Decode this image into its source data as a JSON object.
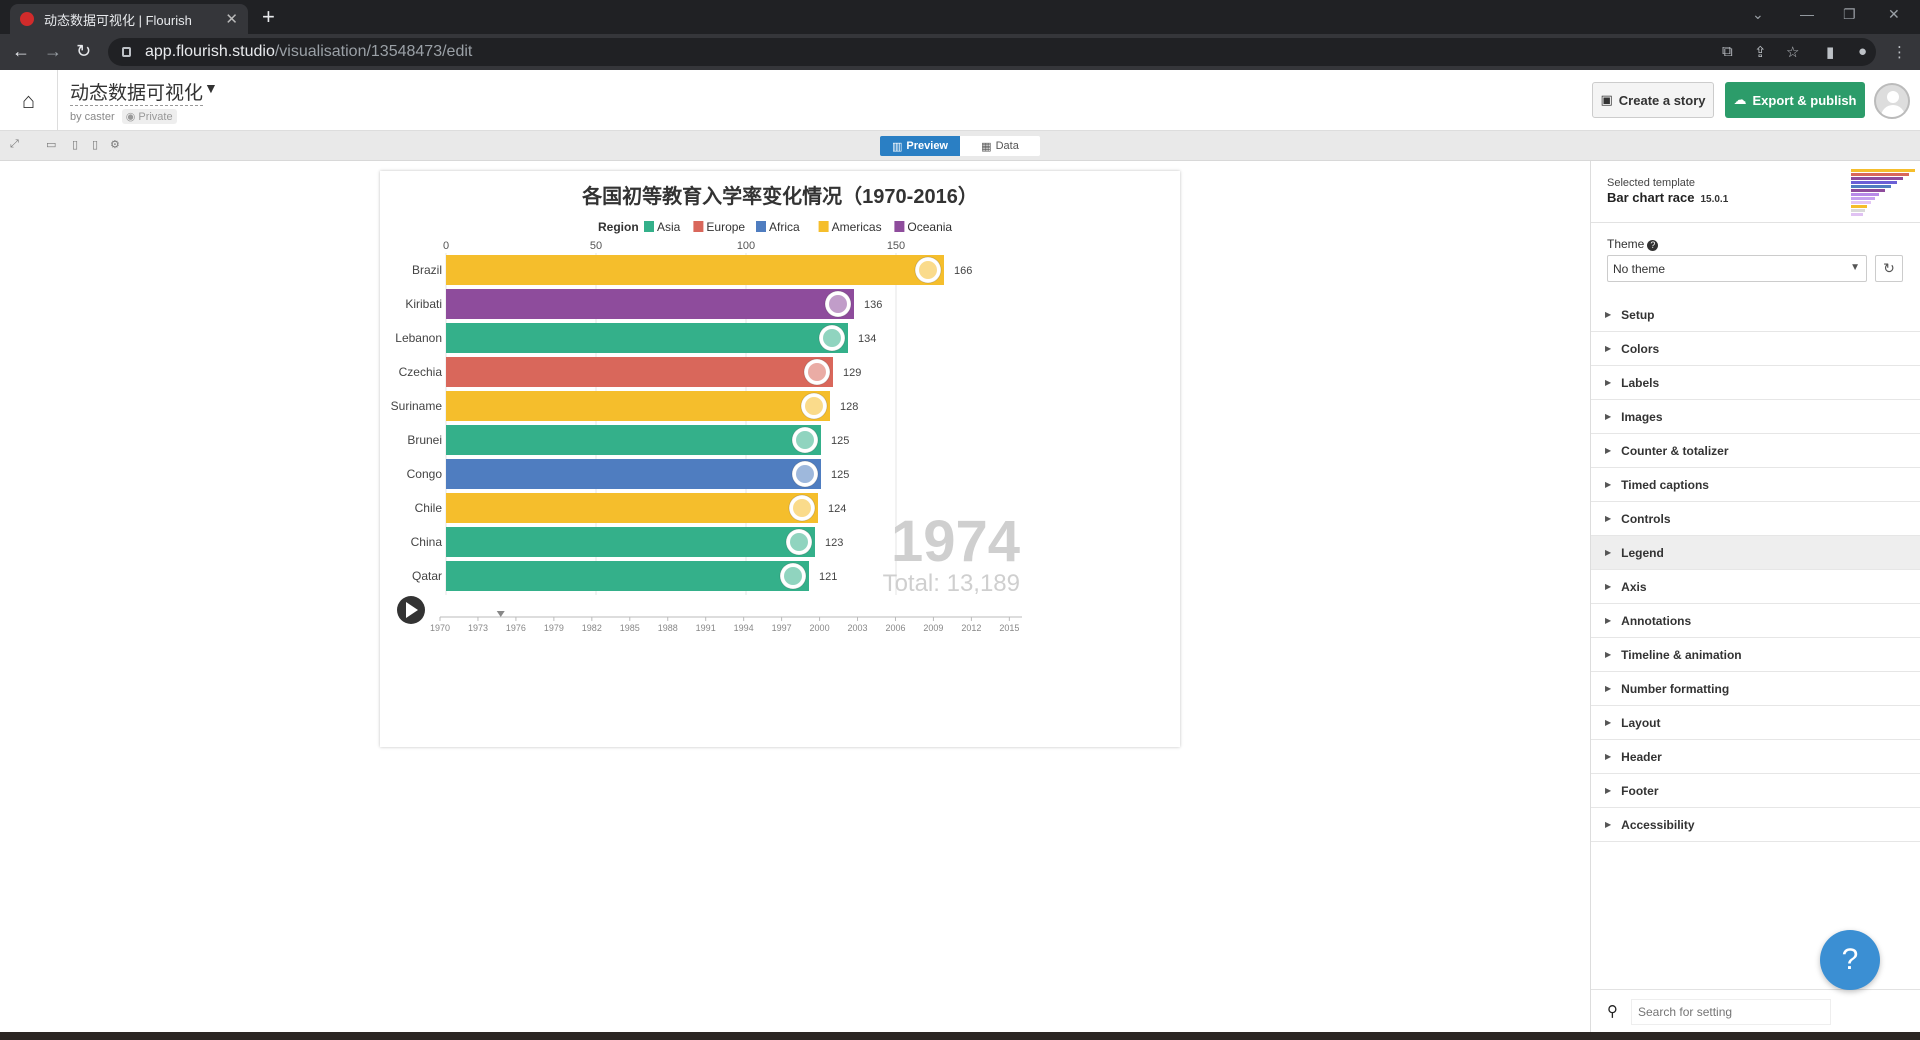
{
  "browser": {
    "tab_title": "动态数据可视化 | Flourish",
    "tab_close": "✕",
    "new_tab": "+",
    "url_host": "app.flourish.studio",
    "url_path": "/visualisation/13548473/edit"
  },
  "header": {
    "project_title": "动态数据可视化",
    "byline": "by caster",
    "privacy": "Private",
    "create_story": "Create a story",
    "export_publish": "Export & publish"
  },
  "toolbar": {
    "preview": "Preview",
    "data": "Data"
  },
  "chart_data": {
    "type": "bar",
    "title": "各国初等教育入学率变化情况（1970-2016）",
    "legend_title": "Region",
    "legend": [
      {
        "name": "Asia",
        "color": "#34b08a"
      },
      {
        "name": "Europe",
        "color": "#d9675b"
      },
      {
        "name": "Africa",
        "color": "#4f7dc0"
      },
      {
        "name": "Americas",
        "color": "#f5be2c"
      },
      {
        "name": "Oceania",
        "color": "#8e4c9c"
      }
    ],
    "categories": [
      "Brazil",
      "Kiribati",
      "Lebanon",
      "Czechia",
      "Suriname",
      "Brunei",
      "Congo",
      "Chile",
      "China",
      "Qatar"
    ],
    "values": [
      166,
      136,
      134,
      129,
      128,
      125,
      125,
      124,
      123,
      121
    ],
    "regions": [
      "Americas",
      "Oceania",
      "Asia",
      "Europe",
      "Americas",
      "Asia",
      "Africa",
      "Americas",
      "Asia",
      "Asia"
    ],
    "x_ticks": [
      0,
      50,
      100,
      150
    ],
    "xlim": [
      0,
      190
    ],
    "current_year": "1974",
    "total_label": "Total: 13,189",
    "timeline_years": [
      "1970",
      "1973",
      "1976",
      "1979",
      "1982",
      "1985",
      "1988",
      "1991",
      "1994",
      "1997",
      "2000",
      "2003",
      "2006",
      "2009",
      "2012",
      "2015"
    ],
    "timeline_range": [
      1970,
      2016
    ],
    "timeline_current": 1974.8
  },
  "panel": {
    "template_label": "Selected template",
    "template_name": "Bar chart race",
    "template_version": "15.0.1",
    "theme_label": "Theme",
    "theme_value": "No theme",
    "sections": [
      "Setup",
      "Colors",
      "Labels",
      "Images",
      "Counter & totalizer",
      "Timed captions",
      "Controls",
      "Legend",
      "Axis",
      "Annotations",
      "Timeline & animation",
      "Number formatting",
      "Layout",
      "Header",
      "Footer",
      "Accessibility"
    ],
    "highlighted_section": "Legend",
    "search_placeholder": "Search for setting"
  },
  "help": {
    "label": "?"
  }
}
